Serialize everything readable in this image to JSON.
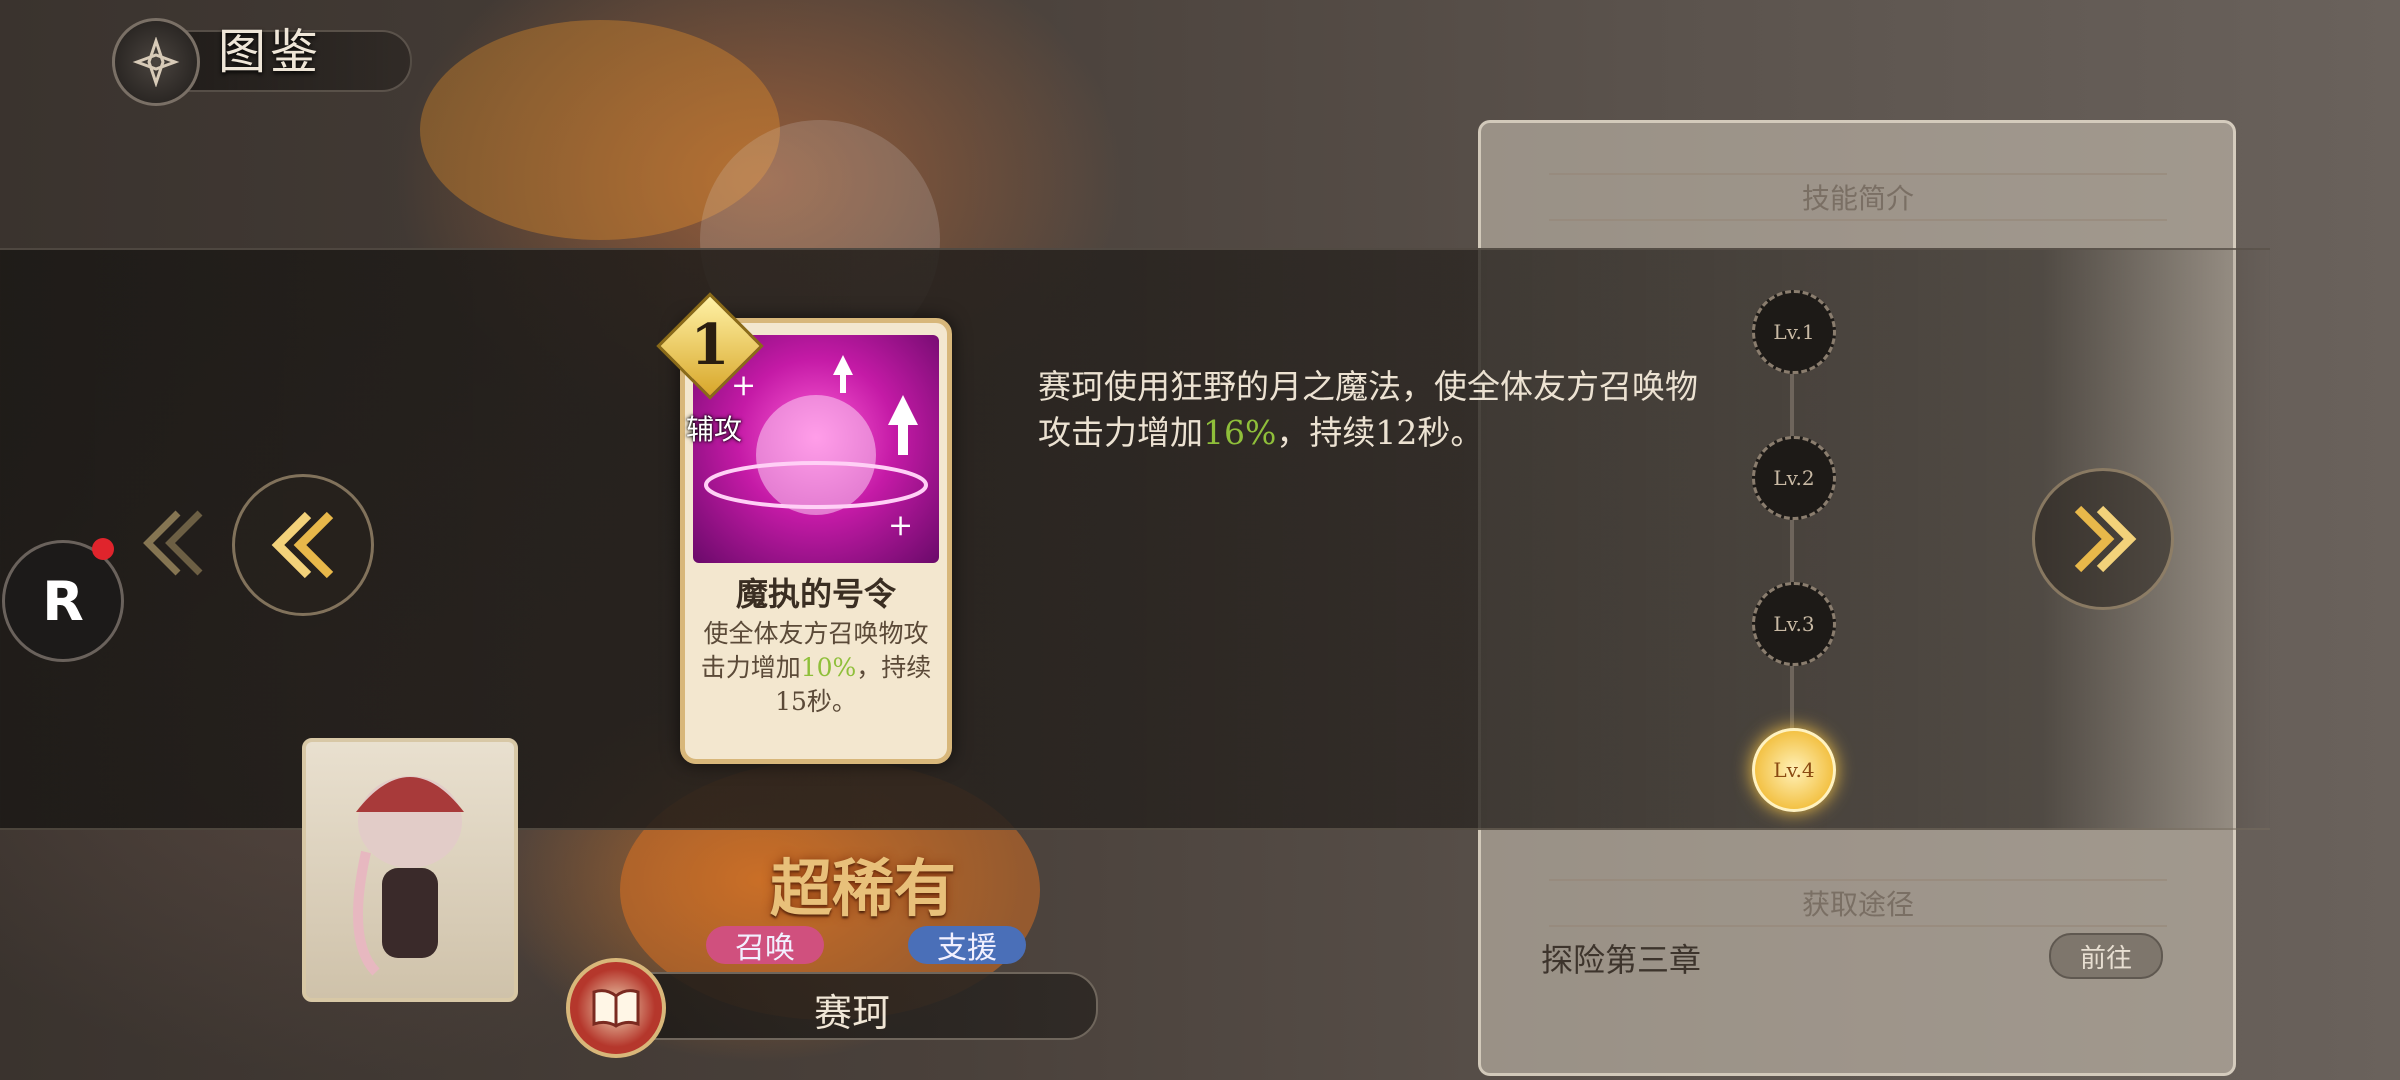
{
  "header": {
    "title": "图鉴",
    "icon": "compass-diamond-icon"
  },
  "skill_panel": {
    "intro_label": "技能简介",
    "source_label": "获取途径",
    "source_text": "探险第三章",
    "goto_label": "前往"
  },
  "card": {
    "cost": "1",
    "type": "辅攻",
    "name": "魔执的号令",
    "desc_1": "使全体友方召唤物攻击力增加",
    "desc_hl": "10%",
    "desc_2": "，持续15秒。"
  },
  "skill_detail": {
    "desc_1": "赛珂使用狂野的月之魔法，使全体友方召唤物攻击力增加",
    "desc_hl": "16%",
    "desc_2": "，持续12秒。"
  },
  "levels": [
    "Lv.1",
    "Lv.2",
    "Lv.3",
    "Lv.4"
  ],
  "active_level": "Lv.4",
  "character": {
    "rarity": "超稀有",
    "tags": [
      "召唤",
      "支援"
    ],
    "name": "赛珂"
  },
  "r_button": {
    "label": "R",
    "has_notification": true
  },
  "colors": {
    "highlight": "#8fbf3a",
    "active_level": "#f3c246",
    "tag_summon": "#d0507e",
    "tag_support": "#4a6fb8"
  }
}
